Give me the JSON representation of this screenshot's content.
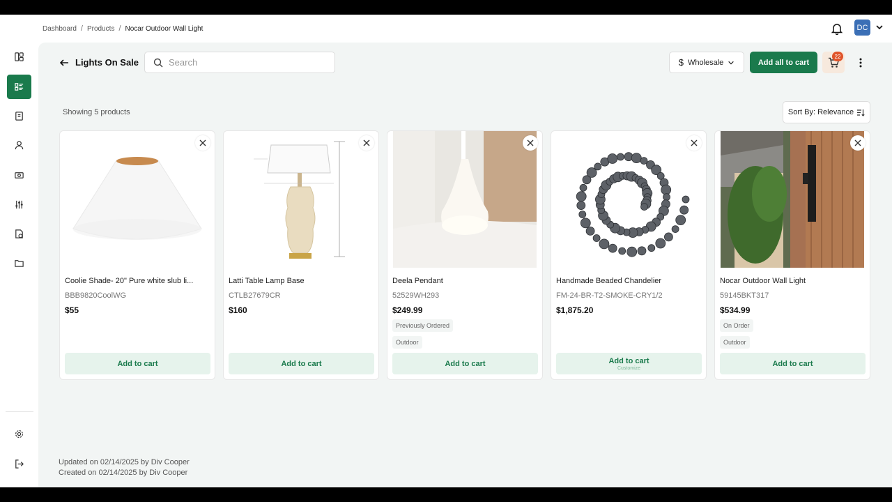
{
  "breadcrumb": {
    "items": [
      "Dashboard",
      "Products"
    ],
    "current": "Nocar Outdoor Wall Light",
    "separator": "/"
  },
  "user": {
    "initials": "DC"
  },
  "header": {
    "title": "Lights On Sale",
    "search_placeholder": "Search",
    "price_mode": "Wholesale",
    "add_all_label": "Add all to cart",
    "cart_count": "22"
  },
  "listing": {
    "showing_text": "Showing 5 products",
    "sort_label": "Sort By: Relevance"
  },
  "products": [
    {
      "name": "Coolie Shade- 20\" Pure white slub li...",
      "sku": "BBB9820CoolWG",
      "price": "$55",
      "tags": [],
      "cta": "Add to cart",
      "cta_sub": ""
    },
    {
      "name": "Latti Table Lamp Base",
      "sku": "CTLB27679CR",
      "price": "$160",
      "tags": [],
      "cta": "Add to cart",
      "cta_sub": ""
    },
    {
      "name": "Deela Pendant",
      "sku": "52529WH293",
      "price": "$249.99",
      "tags": [
        "Previously Ordered",
        "Outdoor"
      ],
      "cta": "Add to cart",
      "cta_sub": ""
    },
    {
      "name": "Handmade Beaded Chandelier",
      "sku": "FM-24-BR-T2-SMOKE-CRY1/2",
      "price": "$1,875.20",
      "tags": [],
      "cta": "Add to cart",
      "cta_sub": "Customize"
    },
    {
      "name": "Nocar Outdoor Wall Light",
      "sku": "59145BKT317",
      "price": "$534.99",
      "tags": [
        "On Order",
        "Outdoor"
      ],
      "cta": "Add to cart",
      "cta_sub": ""
    }
  ],
  "footer": {
    "updated": "Updated on 02/14/2025 by Div Cooper",
    "created": "Created on 02/14/2025 by Div Cooper"
  },
  "colors": {
    "accent": "#1a7a4c",
    "accent_light": "#e6f3ec",
    "badge": "#e0542a",
    "avatar": "#3b6fb6"
  },
  "sidebar_icons": [
    "menu-icon",
    "dashboard-icon",
    "products-icon",
    "orders-icon",
    "customers-icon",
    "payments-icon",
    "settings-sliders-icon",
    "reports-icon",
    "folder-icon",
    "gear-icon",
    "logout-icon"
  ]
}
